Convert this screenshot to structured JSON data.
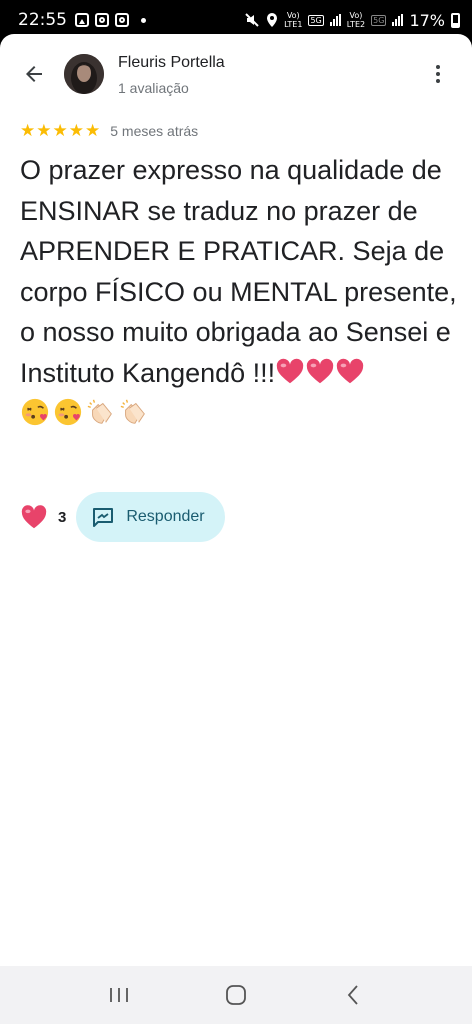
{
  "status_bar": {
    "time": "22:55",
    "net1_top": "Vo)",
    "net1_bottom": "LTE1",
    "net1_type": "5G",
    "net2_top": "Vo)",
    "net2_bottom": "LTE2",
    "net2_type": "5G",
    "battery": "17%"
  },
  "header": {
    "author_name": "Fleuris Portella",
    "review_count": "1 avaliação",
    "back_icon": "arrow-back-icon",
    "menu_icon": "more-vert-icon"
  },
  "review": {
    "rating": 5,
    "max_rating": 5,
    "date": "5 meses atrás",
    "text": "O prazer expresso na qualidade de ENSINAR se traduz no prazer de APRENDER E PRATICAR. Seja de corpo FÍSICO ou MENTAL presente, o nosso muito obrigada ao Sensei e Instituto Kangendô !!!",
    "emojis": [
      "heart",
      "heart",
      "heart",
      "face-blowing-kiss",
      "face-blowing-kiss",
      "clapping-hands",
      "clapping-hands"
    ]
  },
  "actions": {
    "like_count": "3",
    "reply_label": "Responder"
  },
  "colors": {
    "star": "#fbbc04",
    "reply_bg": "#d4f3f8",
    "reply_text": "#1a5c70",
    "heart": "#e8436a"
  }
}
